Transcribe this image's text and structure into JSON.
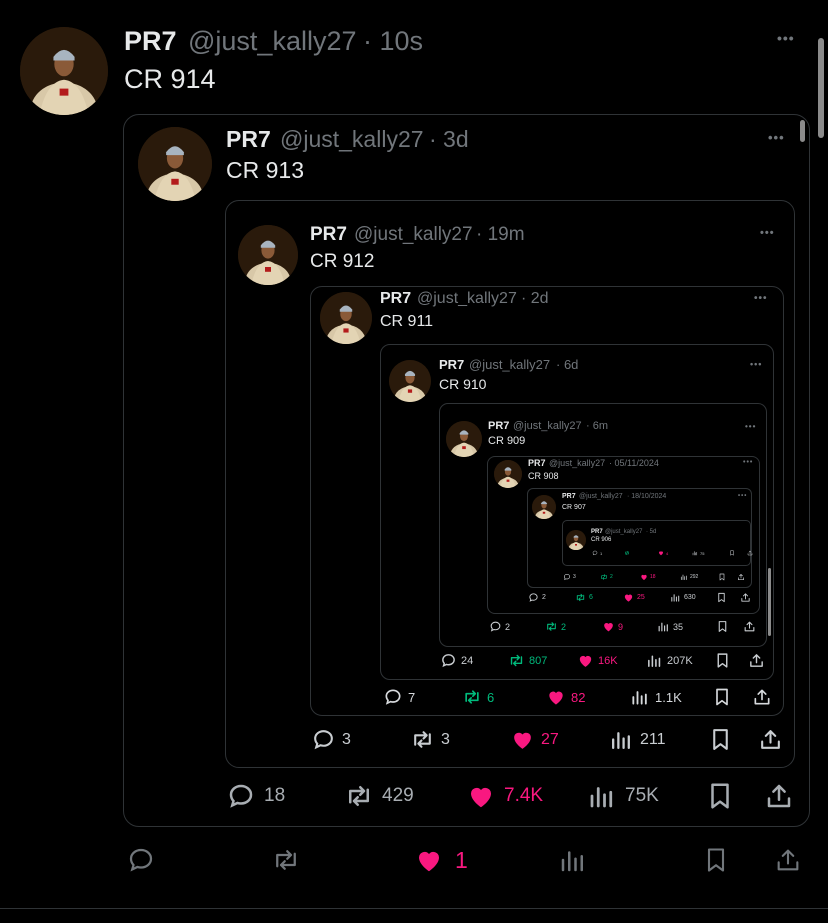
{
  "author": {
    "name": "PR7",
    "handle": "@just_kally27"
  },
  "tweets": [
    {
      "time": "· 10s",
      "text": "CR 914"
    },
    {
      "time": "· 3d",
      "text": "CR 913",
      "stats": {
        "replies": "18",
        "retweets": "429",
        "likes": "7.4K",
        "views": "75K"
      }
    },
    {
      "time": "· 19m",
      "text": "CR 912",
      "stats": {
        "replies": "3",
        "retweets": "3",
        "likes": "27",
        "views": "211"
      }
    },
    {
      "time": "· 2d",
      "text": "CR 911",
      "stats": {
        "replies": "7",
        "retweets": "6",
        "likes": "82",
        "views": "1.1K"
      }
    },
    {
      "time": "· 6d",
      "text": "CR 910",
      "stats": {
        "replies": "24",
        "retweets": "807",
        "likes": "16K",
        "views": "207K"
      }
    },
    {
      "time": "· 6m",
      "text": "CR 909",
      "stats": {
        "replies": "2",
        "retweets": "2",
        "likes": "9",
        "views": "35"
      }
    },
    {
      "time": "· 05/11/2024",
      "text": "CR 908",
      "stats": {
        "replies": "2",
        "retweets": "6",
        "likes": "25",
        "views": "630"
      }
    },
    {
      "time": "· 18/10/2024",
      "text": "CR 907",
      "stats": {
        "replies": "3",
        "retweets": "2",
        "likes": "18",
        "views": "292"
      }
    },
    {
      "time": "· 5d",
      "text": "CR 906",
      "stats": {
        "replies": "1",
        "retweets": "",
        "likes": "4",
        "views": "75"
      }
    }
  ],
  "main_actions": {
    "likes": "1"
  },
  "more_label": "•••",
  "colors": {
    "background": "#000000",
    "text": "#e7e9ea",
    "muted": "#71767b",
    "border": "#2f3336",
    "like": "#f91880",
    "retweet": "#00ba7c"
  }
}
